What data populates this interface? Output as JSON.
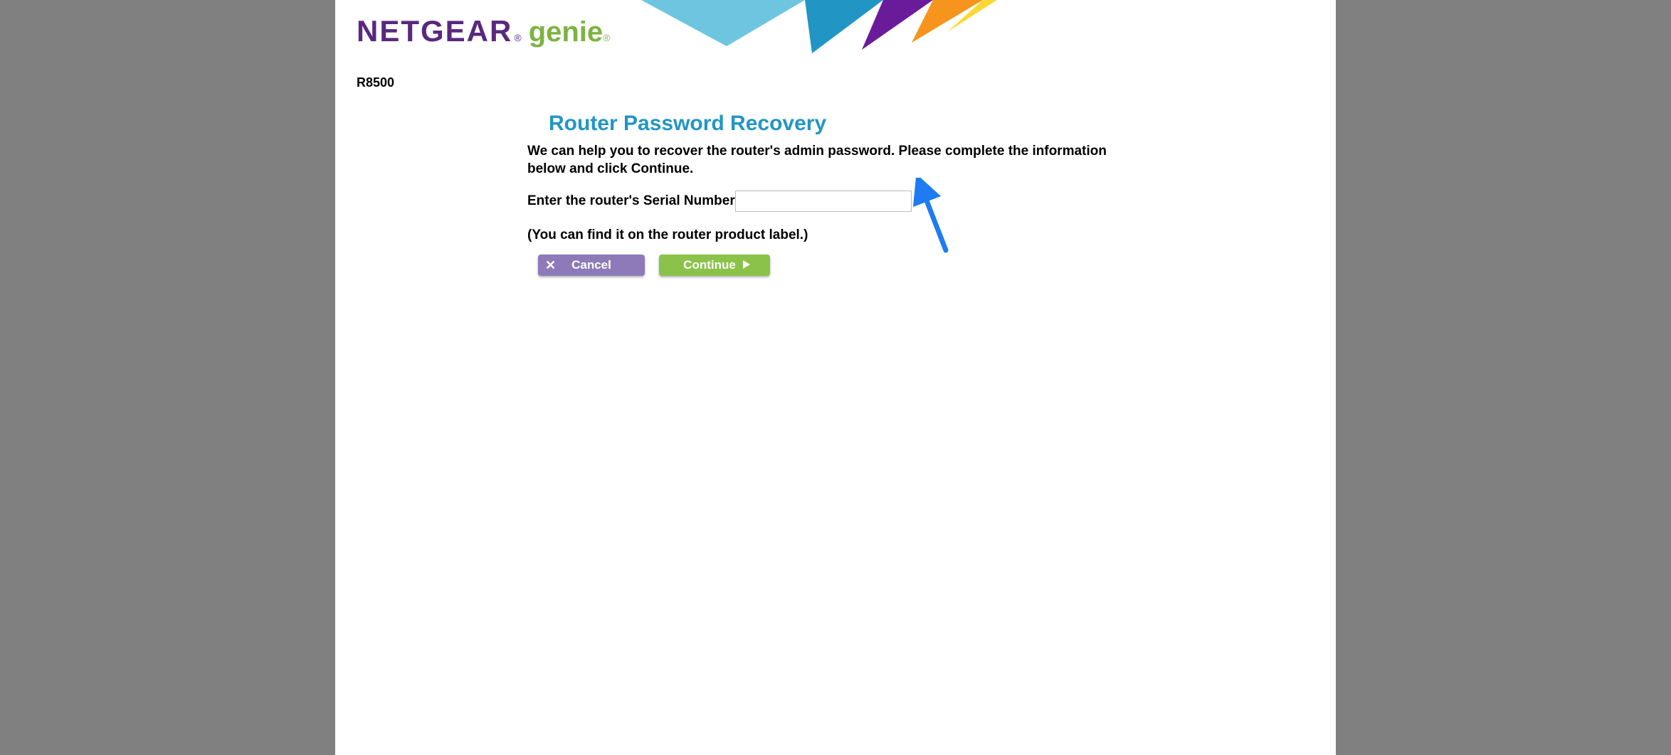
{
  "brand": {
    "name": "NETGEAR",
    "sub": "genie",
    "model": "R8500"
  },
  "page": {
    "title": "Router Password Recovery",
    "description": "We can help you to recover the router's admin password. Please complete the information below and click Continue.",
    "serial_label": "Enter the router's Serial Number",
    "serial_value": "",
    "hint": "(You can find it on the router product label.)"
  },
  "buttons": {
    "cancel": "Cancel",
    "continue": "Continue"
  }
}
